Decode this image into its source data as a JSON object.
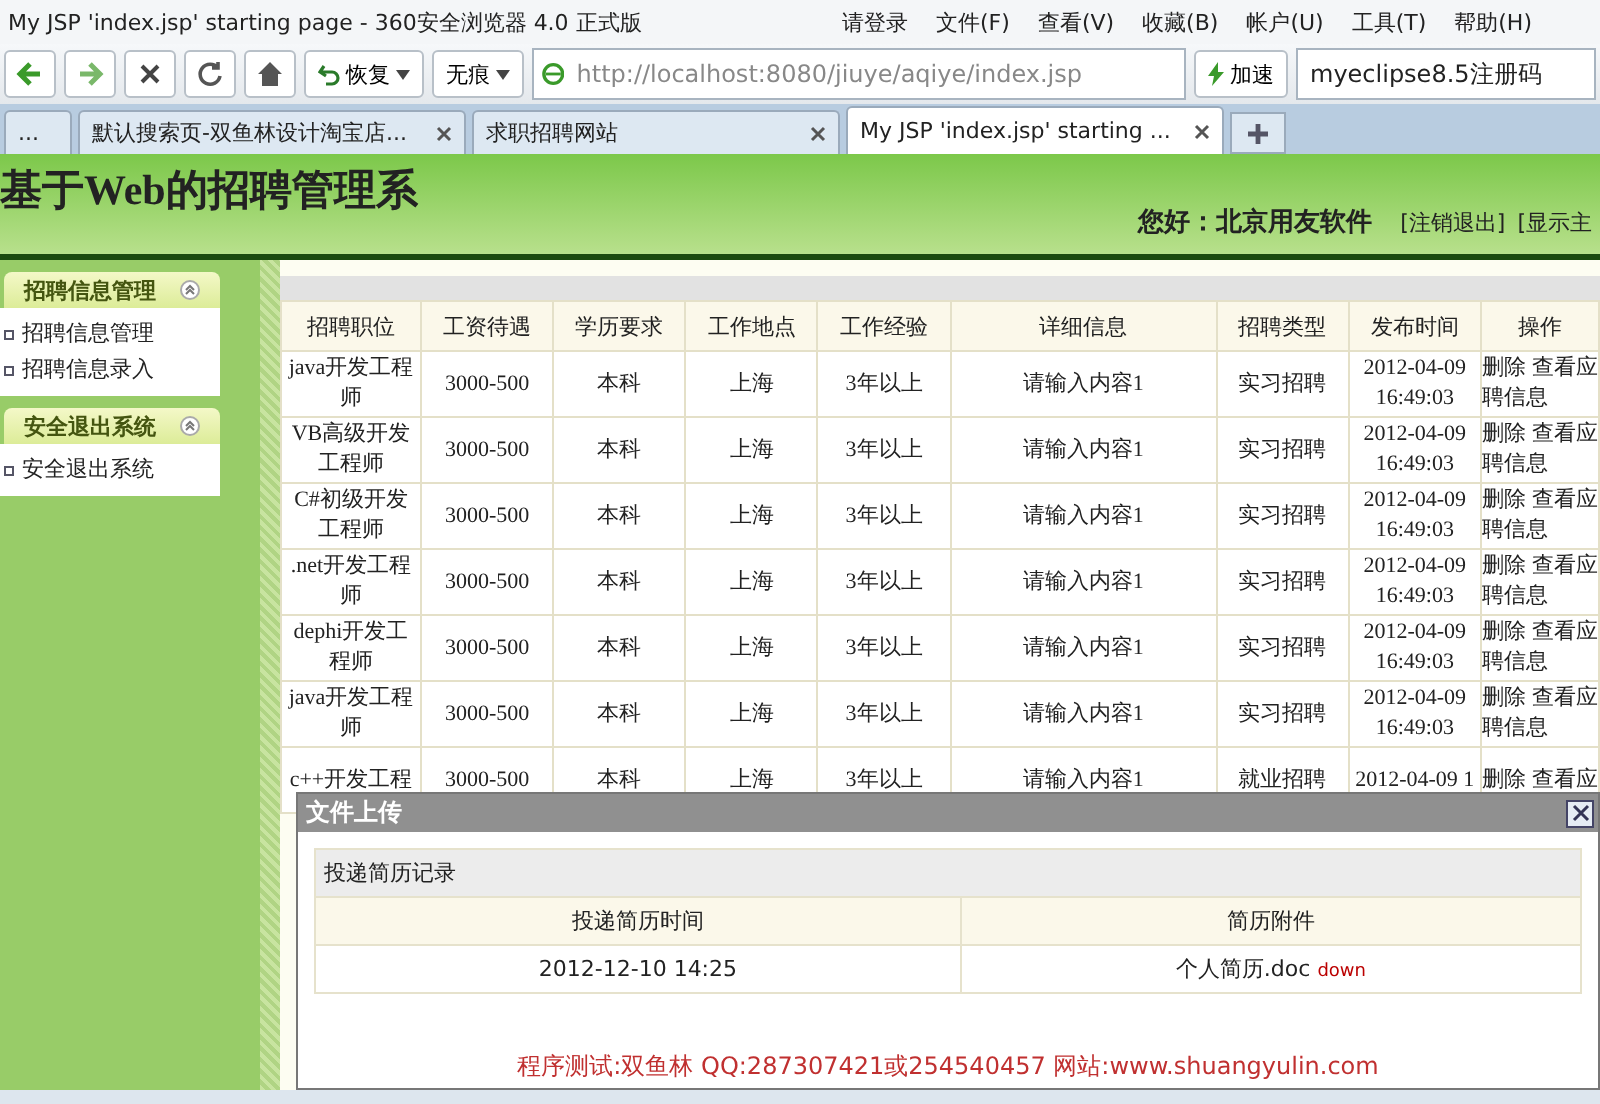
{
  "window": {
    "title": "My JSP 'index.jsp' starting page - 360安全浏览器 4.0 正式版"
  },
  "menu": [
    "请登录",
    "文件(F)",
    "查看(V)",
    "收藏(B)",
    "帐户(U)",
    "工具(T)",
    "帮助(H)"
  ],
  "toolbar": {
    "restore": "恢复",
    "private": "无痕",
    "address": "http://localhost:8080/jiuye/aqiye/index.jsp",
    "speedup": "加速",
    "search": "myeclipse8.5注册码"
  },
  "tabs": [
    {
      "label": "...",
      "selected": false
    },
    {
      "label": "默认搜索页-双鱼林设计淘宝店...",
      "selected": false
    },
    {
      "label": "求职招聘网站",
      "selected": false
    },
    {
      "label": "My JSP 'index.jsp' starting ...",
      "selected": true
    }
  ],
  "header": {
    "title": "基于Web的招聘管理系",
    "greeting": "您好：北京用友软件",
    "links": [
      "[注销退出]",
      "[显示主"
    ]
  },
  "sidebar": [
    {
      "title": "招聘信息管理",
      "items": [
        "招聘信息管理",
        "招聘信息录入"
      ]
    },
    {
      "title": "安全退出系统",
      "items": [
        "安全退出系统"
      ]
    }
  ],
  "table": {
    "columns": [
      "招聘职位",
      "工资待遇",
      "学历要求",
      "工作地点",
      "工作经验",
      "详细信息",
      "招聘类型",
      "发布时间",
      "操作"
    ],
    "rows": [
      [
        "java开发工程师",
        "3000-500",
        "本科",
        "上海",
        "3年以上",
        "请输入内容1",
        "实习招聘",
        "2012-04-09 16:49:03",
        "删除",
        "查看应聘信息"
      ],
      [
        "VB高级开发工程师",
        "3000-500",
        "本科",
        "上海",
        "3年以上",
        "请输入内容1",
        "实习招聘",
        "2012-04-09 16:49:03",
        "删除",
        "查看应聘信息"
      ],
      [
        "C#初级开发工程师",
        "3000-500",
        "本科",
        "上海",
        "3年以上",
        "请输入内容1",
        "实习招聘",
        "2012-04-09 16:49:03",
        "删除",
        "查看应聘信息"
      ],
      [
        ".net开发工程师",
        "3000-500",
        "本科",
        "上海",
        "3年以上",
        "请输入内容1",
        "实习招聘",
        "2012-04-09 16:49:03",
        "删除",
        "查看应聘信息"
      ],
      [
        "dephi开发工程师",
        "3000-500",
        "本科",
        "上海",
        "3年以上",
        "请输入内容1",
        "实习招聘",
        "2012-04-09 16:49:03",
        "删除",
        "查看应聘信息"
      ],
      [
        "java开发工程师",
        "3000-500",
        "本科",
        "上海",
        "3年以上",
        "请输入内容1",
        "实习招聘",
        "2012-04-09 16:49:03",
        "删除",
        "查看应聘信息"
      ],
      [
        "c++开发工程",
        "3000-500",
        "本科",
        "上海",
        "3年以上",
        "请输入内容1",
        "就业招聘",
        "2012-04-09 1",
        "删除",
        "查看应"
      ]
    ]
  },
  "dialog": {
    "title": "文件上传",
    "section": "投递简历记录",
    "columns": [
      "投递简历时间",
      "简历附件"
    ],
    "rows": [
      {
        "time": "2012-12-10 14:25",
        "file": "个人简历.doc",
        "link": "down"
      }
    ],
    "footer": "程序测试:双鱼林 QQ:287307421或254540457 网站:www.shuangyulin.com"
  }
}
